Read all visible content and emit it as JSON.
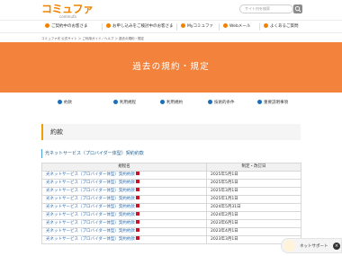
{
  "header": {
    "logo_text": "コミュファ",
    "logo_sub": "commufa",
    "search_placeholder": "サイト内を検索"
  },
  "gnav": {
    "items": [
      {
        "label": "ご契約中のお客さま"
      },
      {
        "label": "お申し込みをご検討中のお客さま"
      },
      {
        "label": "Myコミュファ"
      },
      {
        "label": "Webメール"
      },
      {
        "label": "よくあるご質問"
      }
    ]
  },
  "breadcrumb": "コミュファ光 公式サイト ＞ ご利用ガイド／ヘルプ ＞ 過去の規約・規定",
  "hero": {
    "title": "過去の規約・規定"
  },
  "anchors": [
    {
      "label": "約款"
    },
    {
      "label": "利用規程"
    },
    {
      "label": "利用規約"
    },
    {
      "label": "技術的条件"
    },
    {
      "label": "重要説明事項"
    }
  ],
  "section": {
    "title": "約款"
  },
  "subsection": {
    "title": "光ネットサービス（プロバイダー体型）契約約款"
  },
  "table": {
    "headers": [
      "規程名",
      "制定・改訂日"
    ],
    "rows": [
      {
        "doc": "光ネットサービス（プロバイダー体型）契約約款",
        "date": "2025年5月1日"
      },
      {
        "doc": "光ネットサービス（プロバイダー体型）契約約款",
        "date": "2025年5月1日"
      },
      {
        "doc": "光ネットサービス（プロバイダー体型）契約約款",
        "date": "2025年3月1日"
      },
      {
        "doc": "光ネットサービス（プロバイダー体型）契約約款",
        "date": "2025年1月1日"
      },
      {
        "doc": "光ネットサービス（プロバイダー体型）契約約款",
        "date": "2024年5月31日"
      },
      {
        "doc": "光ネットサービス（プロバイダー体型）契約約款",
        "date": "2024年2月1日"
      },
      {
        "doc": "光ネットサービス（プロバイダー体型）契約約款",
        "date": "2023年6月1日"
      },
      {
        "doc": "光ネットサービス（プロバイダー体型）契約約款",
        "date": "2023年4月1日"
      },
      {
        "doc": "光ネットサービス（プロバイダー体型）契約約款",
        "date": "2023年3月1日"
      }
    ]
  },
  "support": {
    "label": "ネットサポート"
  },
  "colors": {
    "accent": "#f08200",
    "hero": "#f3833c",
    "link": "#2b6fb4",
    "anchor_icon": "#1b6fb8"
  }
}
